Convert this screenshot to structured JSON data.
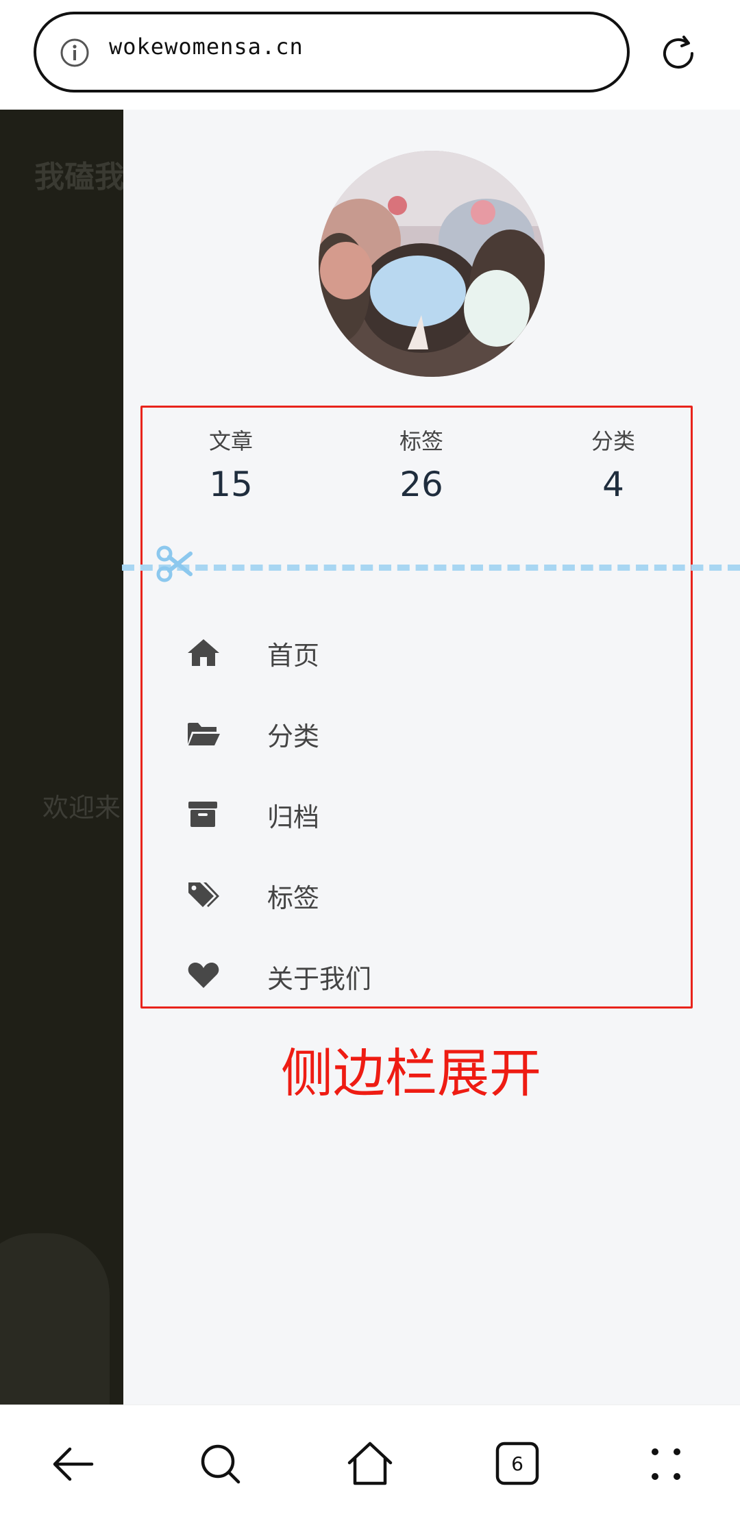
{
  "browser": {
    "url": "wokewomensa.cn",
    "tab_count": "6"
  },
  "background_page": {
    "title": "我磕我",
    "welcome": "欢迎来"
  },
  "sidebar": {
    "stats": [
      {
        "label": "文章",
        "value": "15"
      },
      {
        "label": "标签",
        "value": "26"
      },
      {
        "label": "分类",
        "value": "4"
      }
    ],
    "menu": [
      {
        "label": "首页",
        "icon": "home-icon"
      },
      {
        "label": "分类",
        "icon": "folder-open-icon"
      },
      {
        "label": "归档",
        "icon": "archive-icon"
      },
      {
        "label": "标签",
        "icon": "tags-icon"
      },
      {
        "label": "关于我们",
        "icon": "heart-icon"
      }
    ]
  },
  "annotation": {
    "caption": "侧边栏展开",
    "color": "#ee1c13"
  },
  "colors": {
    "drawer_bg": "#f5f6f8",
    "divider": "#a8d6f2",
    "backdrop": "#1f1f17"
  }
}
